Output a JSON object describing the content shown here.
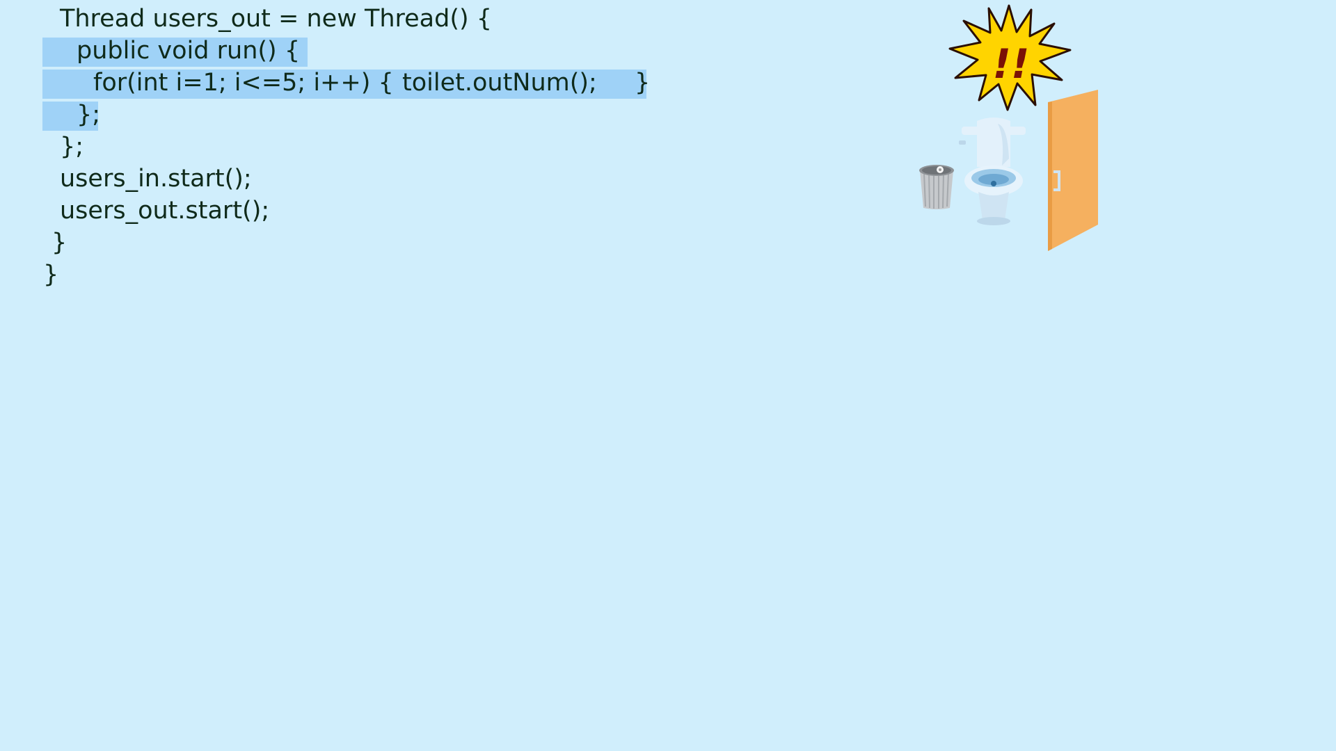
{
  "code": {
    "lines": [
      "Thread users_out = new Thread() {",
      "public void run() {",
      "for(int i=1; i<=5; i++) {",
      "toilet.outNum();",
      "}",
      "};",
      "};",
      "users_in.start();",
      "users_out.start();",
      "}",
      "}"
    ]
  },
  "illustration": {
    "burst_text": "!!",
    "colors": {
      "background": "#d0eefc",
      "highlight": "#9fd2f7",
      "door": "#f5b05f",
      "burst_fill": "#ffd400",
      "burst_text": "#7a1206"
    }
  }
}
